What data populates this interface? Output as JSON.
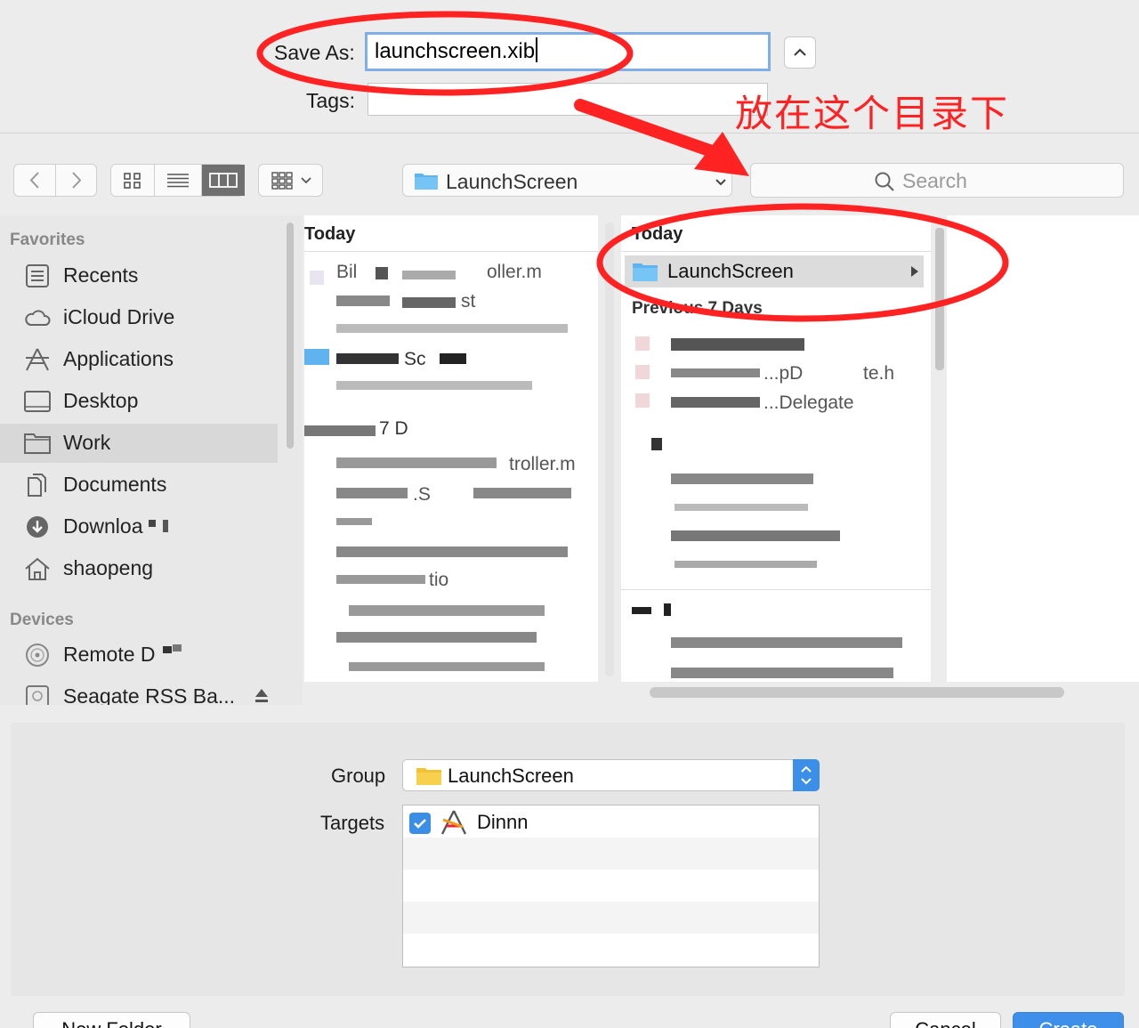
{
  "save": {
    "label": "Save As:",
    "filename": "launchscreen.xib",
    "tags_label": "Tags:",
    "tags_value": ""
  },
  "toolbar": {
    "location": "LaunchScreen",
    "search_placeholder": "Search"
  },
  "sidebar": {
    "favorites_header": "Favorites",
    "items": [
      {
        "label": "Recents",
        "icon": "recents-icon"
      },
      {
        "label": "iCloud Drive",
        "icon": "cloud-icon"
      },
      {
        "label": "Applications",
        "icon": "applications-icon"
      },
      {
        "label": "Desktop",
        "icon": "desktop-icon"
      },
      {
        "label": "Work",
        "icon": "folder-icon"
      },
      {
        "label": "Documents",
        "icon": "documents-icon"
      },
      {
        "label": "Downloa",
        "icon": "download-icon"
      },
      {
        "label": "shaopeng",
        "icon": "home-icon"
      }
    ],
    "devices_header": "Devices",
    "devices": [
      {
        "label": "Remote D",
        "icon": "disc-icon"
      },
      {
        "label": "Seagate RSS Ba...",
        "icon": "drive-icon"
      }
    ]
  },
  "column1": {
    "header_today": "Today",
    "header_previous": "7 D",
    "files": [
      "Bil",
      "oller.m",
      "st",
      "Sc",
      "troller.m",
      ".S",
      "tio"
    ]
  },
  "column2": {
    "header_today": "Today",
    "selected_folder": "LaunchScreen",
    "header_previous": "Previous 7 Days",
    "files": [
      "...pD",
      "te.h",
      "...Delegate"
    ]
  },
  "panel": {
    "group_label": "Group",
    "group_value": "LaunchScreen",
    "targets_label": "Targets",
    "targets": [
      {
        "name": "Dinnn",
        "checked": true
      }
    ]
  },
  "buttons": {
    "new_folder": "New Folder",
    "cancel": "Cancel",
    "create": "Create"
  },
  "annotation": {
    "text": "放在这个目录下",
    "color": "#ff2222"
  }
}
